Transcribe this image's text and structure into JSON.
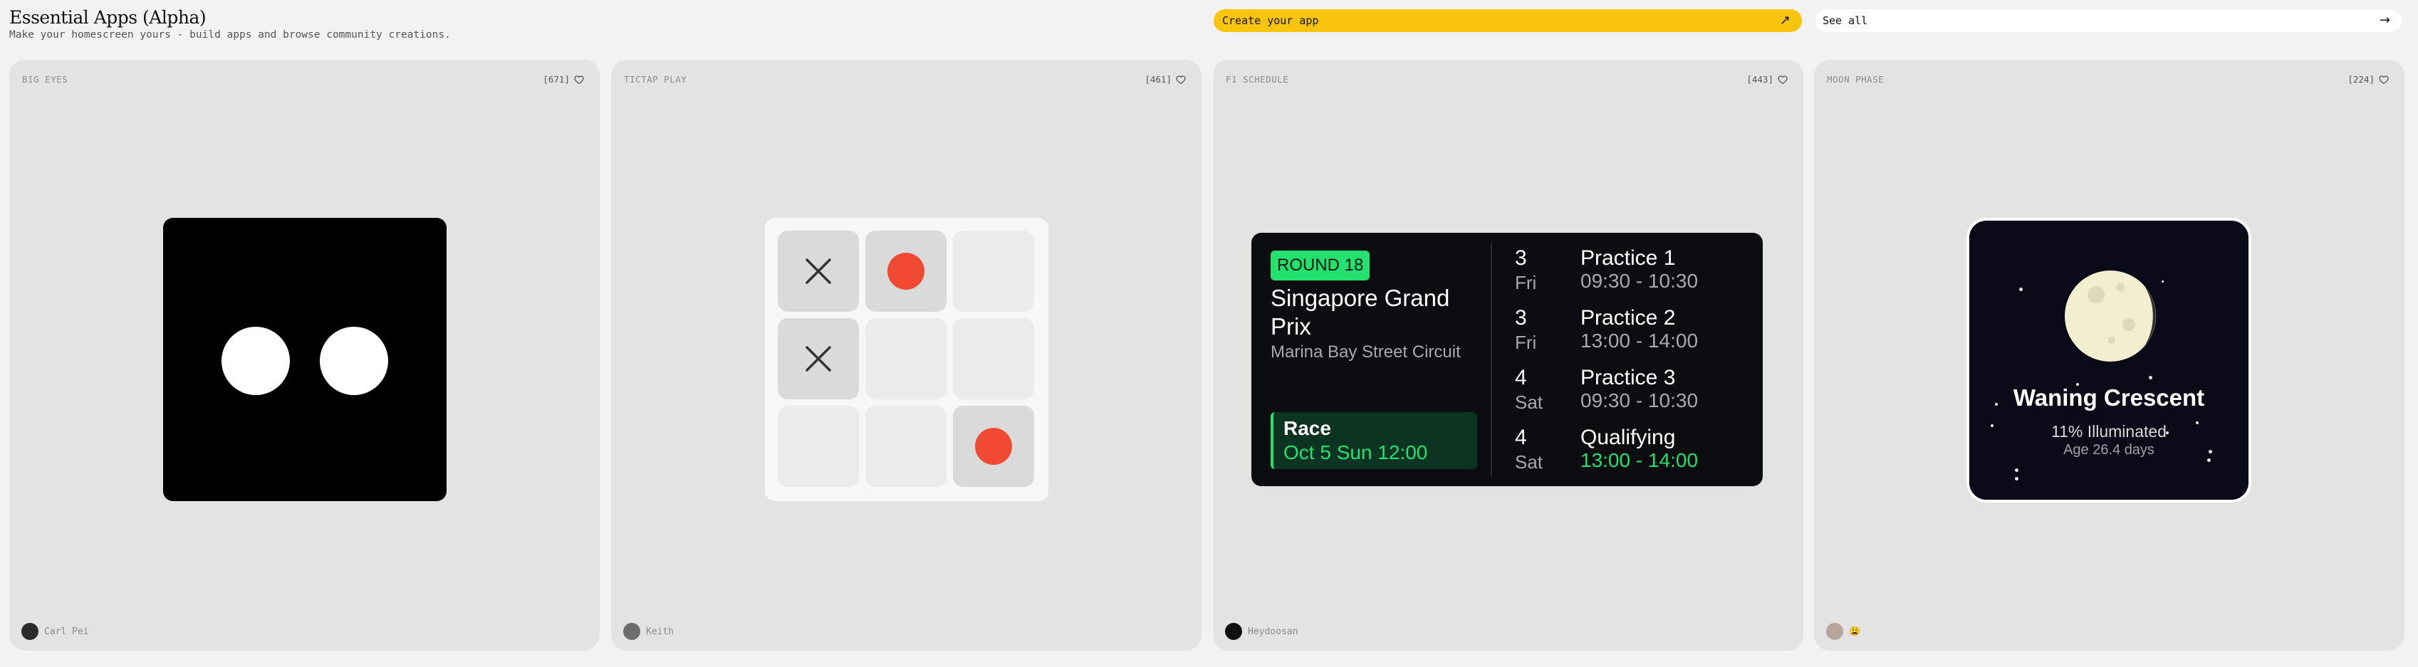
{
  "header": {
    "title": "Essential Apps (Alpha)",
    "subtitle": "Make your homescreen yours - build apps and browse community creations.",
    "create_button": "Create your app",
    "create_icon": "arrow-up-right-icon",
    "see_all_button": "See all",
    "see_all_icon": "arrow-right-icon"
  },
  "colors": {
    "page_bg": "#f2f2f2",
    "card_bg": "#e3e3e3",
    "create_button_bg": "#f8c40d",
    "f1_accent": "#23e06f",
    "ttt_o": "#f04a32"
  },
  "cards": [
    {
      "label": "BIG EYES",
      "likes": "[671]",
      "author": "Carl Pei"
    },
    {
      "label": "TICTAP PLAY",
      "likes": "[461]",
      "author": "Keith",
      "board": [
        "X",
        "O",
        "",
        "X",
        "",
        "",
        "",
        "",
        "O"
      ]
    },
    {
      "label": "F1 SCHEDULE",
      "likes": "[443]",
      "author": "Heydoosan",
      "widget": {
        "round": "ROUND 18",
        "grand_prix": "Singapore Grand Prix",
        "circuit": "Marina Bay Street Circuit",
        "race_label": "Race",
        "race_time": "Oct 5 Sun 12:00",
        "sessions": [
          {
            "day_num": "3",
            "day_name": "Fri",
            "name": "Practice 1",
            "time": "09:30 - 10:30"
          },
          {
            "day_num": "3",
            "day_name": "Fri",
            "name": "Practice 2",
            "time": "13:00 - 14:00"
          },
          {
            "day_num": "4",
            "day_name": "Sat",
            "name": "Practice 3",
            "time": "09:30 - 10:30"
          },
          {
            "day_num": "4",
            "day_name": "Sat",
            "name": "Qualifying",
            "time": "13:00 - 14:00"
          }
        ]
      }
    },
    {
      "label": "MOON PHASE",
      "likes": "[224]",
      "author": "😩",
      "widget": {
        "phase": "Waning Crescent",
        "illumination": "11% Illuminated",
        "age": "Age 26.4 days"
      }
    }
  ]
}
